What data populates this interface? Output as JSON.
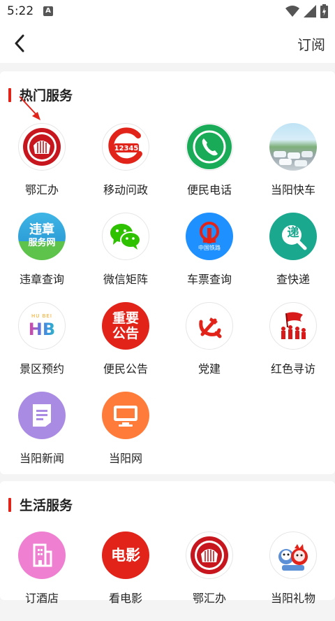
{
  "status": {
    "time": "5:22"
  },
  "header": {
    "subscribe_label": "订阅"
  },
  "sections": [
    {
      "title": "热门服务",
      "items": [
        {
          "label": "鄂汇办",
          "icon": "hubei-seal-icon"
        },
        {
          "label": "移动问政",
          "icon": "12345-hotline-icon"
        },
        {
          "label": "便民电话",
          "icon": "phone-icon"
        },
        {
          "label": "当阳快车",
          "icon": "car-photo-icon"
        },
        {
          "label": "违章查询",
          "icon": "traffic-violation-icon",
          "text": [
            "违章",
            "服务网"
          ]
        },
        {
          "label": "微信矩阵",
          "icon": "wechat-icon"
        },
        {
          "label": "车票查询",
          "icon": "china-railway-icon",
          "text": [
            "中国铁路"
          ]
        },
        {
          "label": "查快递",
          "icon": "express-icon",
          "text": [
            "递"
          ]
        },
        {
          "label": "景区预约",
          "icon": "hubei-tourism-icon",
          "text": [
            "HU BEI",
            "HB"
          ]
        },
        {
          "label": "便民公告",
          "icon": "notice-icon",
          "text": [
            "重要",
            "公告"
          ]
        },
        {
          "label": "党建",
          "icon": "party-emblem-icon"
        },
        {
          "label": "红色寻访",
          "icon": "red-flag-icon"
        },
        {
          "label": "当阳新闻",
          "icon": "news-document-icon"
        },
        {
          "label": "当阳网",
          "icon": "monitor-icon"
        }
      ]
    },
    {
      "title": "生活服务",
      "items": [
        {
          "label": "订酒店",
          "icon": "hotel-building-icon"
        },
        {
          "label": "看电影",
          "icon": "movie-icon",
          "text": [
            "电影"
          ]
        },
        {
          "label": "鄂汇办",
          "icon": "hubei-seal-icon"
        },
        {
          "label": "当阳礼物",
          "icon": "gift-mascot-icon"
        }
      ]
    }
  ],
  "colors": {
    "accent": "#e2231a",
    "phone": "#1aab58",
    "wechat": "#2dc100",
    "railway": "#1e90ff",
    "express": "#1aa88f",
    "news": "#a98be3",
    "web": "#ff7b3a",
    "hotel": "#ef7fd0"
  }
}
